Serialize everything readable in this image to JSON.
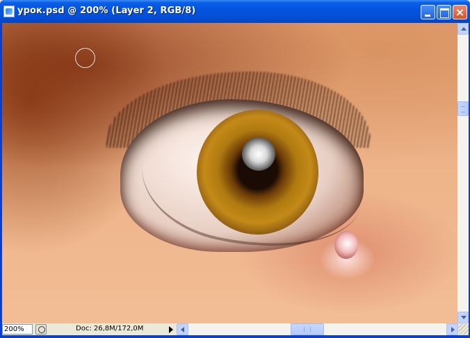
{
  "window": {
    "title": "урок.psd @ 200% (Layer 2, RGB/8)",
    "icon": "photoshop-document-icon",
    "controls": {
      "minimize": "minimize-icon",
      "maximize": "maximize-icon",
      "close": "×"
    }
  },
  "canvas": {
    "content": "painted-eye-image",
    "tool_cursor": "brush-circle-cursor"
  },
  "statusbar": {
    "zoom": "200%",
    "doc_info": "Doc: 26,8M/172,0M"
  },
  "colors": {
    "titlebar": "#0454e0",
    "close_button": "#d8532c",
    "chrome": "#ece9d8"
  }
}
